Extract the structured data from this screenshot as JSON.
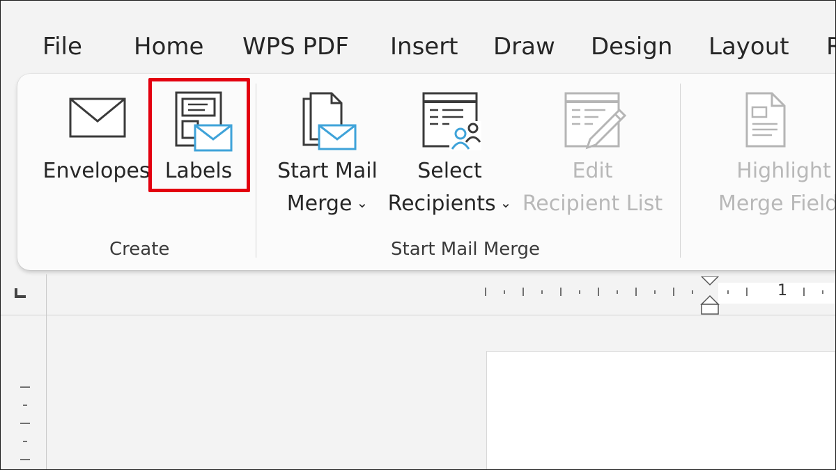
{
  "tabs": [
    "File",
    "Home",
    "WPS PDF",
    "Insert",
    "Draw",
    "Design",
    "Layout",
    "R"
  ],
  "create_group": {
    "label": "Create",
    "envelopes": "Envelopes",
    "labels": "Labels"
  },
  "mail_merge_group": {
    "label": "Start Mail Merge",
    "start_mail_merge": [
      "Start Mail",
      "Merge"
    ],
    "select_recipients": [
      "Select",
      "Recipients"
    ],
    "edit_recipient_list": [
      "Edit",
      "Recipient List"
    ]
  },
  "write_insert_group": {
    "highlight_merge_fields": [
      "Highlight",
      "Merge Fields"
    ]
  },
  "ruler": {
    "number": "1"
  },
  "icons": {
    "envelope": "envelope-icon",
    "labels": "labels-icon",
    "start_mail_merge": "documents-envelope-icon",
    "select_recipients": "contacts-list-icon",
    "edit_recipient_list": "edit-list-icon",
    "highlight_merge_fields": "document-fields-icon",
    "dropdown": "chevron-down-icon"
  },
  "colors": {
    "accent_blue": "#3fa3d9",
    "highlight_red": "#e3000f",
    "disabled_text": "#b8b8b8"
  }
}
